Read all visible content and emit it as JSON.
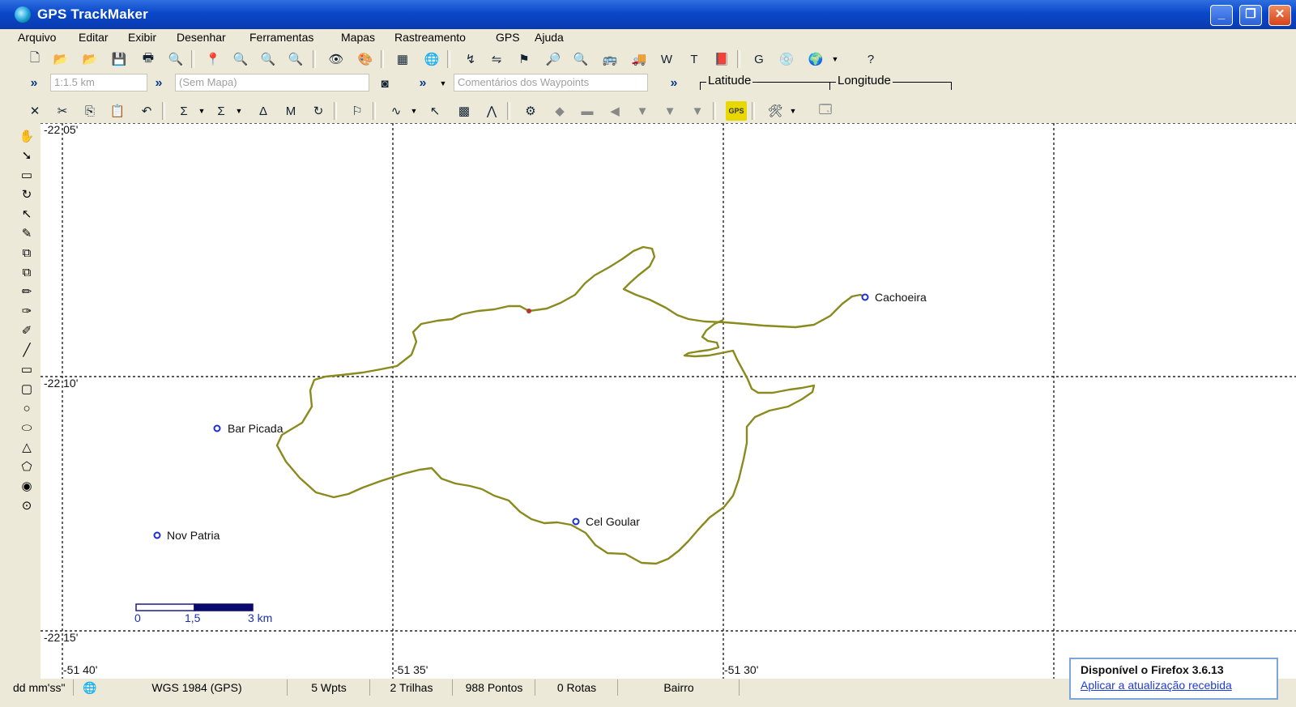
{
  "window": {
    "title": "GPS TrackMaker",
    "buttons": {
      "minimize": "_",
      "maximize": "❐",
      "close": "✕"
    }
  },
  "menu": [
    "Arquivo",
    "Editar",
    "Exibir",
    "Desenhar",
    "Ferramentas",
    "Mapas",
    "Rastreamento",
    "GPS",
    "Ajuda"
  ],
  "toolbar2": {
    "scale_value": "1:1.5 km",
    "map_value": "(Sem Mapa)",
    "comments_placeholder": "Comentários dos Waypoints",
    "latitude_label": "Latitude",
    "longitude_label": "Longitude"
  },
  "map": {
    "grid_labels": {
      "lat_1": "-22 05'",
      "lat_2": "-22 10'",
      "lat_3": "-22 15'",
      "lon_1": "-51 40'",
      "lon_2": "-51 35'",
      "lon_3": "-51 30'"
    },
    "waypoints": [
      "Bar Picada",
      "Nov Patria",
      "Cel Goular",
      "Cachoeira"
    ],
    "scalebar": {
      "l0": "0",
      "l1": "1,5",
      "l2": "3 km"
    },
    "track_color": "#8a8a1e"
  },
  "status": {
    "format": "dd mm'ss\"",
    "datum": "WGS 1984 (GPS)",
    "wpts": "5 Wpts",
    "trilhas": "2 Trilhas",
    "pontos": "988 Pontos",
    "rotas": "0 Rotas",
    "bairro": "Bairro"
  },
  "notification": {
    "heading": "Disponível o Firefox 3.6.13",
    "link": "Aplicar a atualização recebida"
  }
}
